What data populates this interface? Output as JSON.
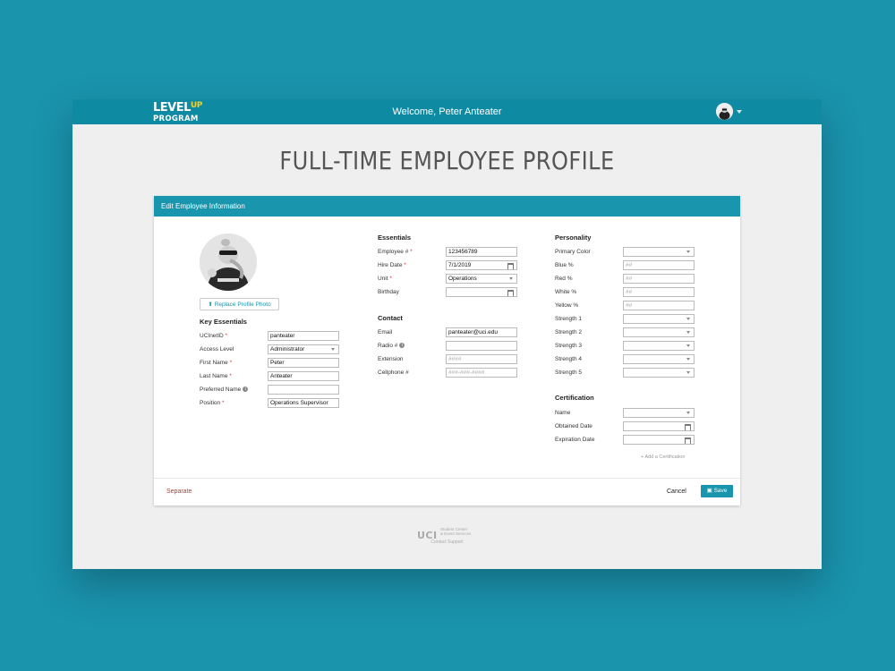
{
  "app": {
    "logo_line1": "LEVEL",
    "logo_up": "UP",
    "logo_line2": "PROGRAM",
    "welcome": "Welcome, Peter Anteater",
    "page_title": "FULL-TIME EMPLOYEE PROFILE"
  },
  "card": {
    "header": "Edit Employee Information",
    "replace_photo": "Replace Profile Photo"
  },
  "key_essentials": {
    "title": "Key Essentials",
    "fields": [
      {
        "label": "UCInetID",
        "required": "*",
        "value": "panteater"
      },
      {
        "label": "Access Level",
        "required": "",
        "value": "Administrator"
      },
      {
        "label": "First Name",
        "required": "*",
        "value": "Peter"
      },
      {
        "label": "Last Name",
        "required": "*",
        "value": "Anteater"
      },
      {
        "label": "Preferred Name",
        "required": "",
        "value": ""
      },
      {
        "label": "Position",
        "required": "*",
        "value": "Operations Supervisor"
      }
    ]
  },
  "essentials": {
    "title": "Essentials",
    "fields": [
      {
        "label": "Employee #",
        "required": "*",
        "value": "123456789"
      },
      {
        "label": "Hire Date",
        "required": "*",
        "value": "7/1/2019"
      },
      {
        "label": "Unit",
        "required": "*",
        "value": "Operations"
      },
      {
        "label": "Birthday",
        "required": "",
        "value": ""
      }
    ]
  },
  "contact": {
    "title": "Contact",
    "fields": [
      {
        "label": "Email",
        "value": "panteater@uci.edu",
        "placeholder": ""
      },
      {
        "label": "Radio #",
        "value": "",
        "placeholder": ""
      },
      {
        "label": "Extension",
        "value": "",
        "placeholder": "####"
      },
      {
        "label": "Cellphone #",
        "value": "",
        "placeholder": "###-###-####"
      }
    ]
  },
  "personality": {
    "title": "Personality",
    "fields": [
      {
        "label": "Primary Color",
        "value": "",
        "placeholder": ""
      },
      {
        "label": "Blue %",
        "value": "",
        "placeholder": "##"
      },
      {
        "label": "Red %",
        "value": "",
        "placeholder": "##"
      },
      {
        "label": "White %",
        "value": "",
        "placeholder": "##"
      },
      {
        "label": "Yellow %",
        "value": "",
        "placeholder": "##"
      },
      {
        "label": "Strength 1",
        "value": "",
        "placeholder": ""
      },
      {
        "label": "Strength 2",
        "value": "",
        "placeholder": ""
      },
      {
        "label": "Strength 3",
        "value": "",
        "placeholder": ""
      },
      {
        "label": "Strength 4",
        "value": "",
        "placeholder": ""
      },
      {
        "label": "Strength 5",
        "value": "",
        "placeholder": ""
      }
    ]
  },
  "certification": {
    "title": "Certification",
    "fields": [
      {
        "label": "Name",
        "value": ""
      },
      {
        "label": "Obtained Date",
        "value": ""
      },
      {
        "label": "Expiration Date",
        "value": ""
      }
    ],
    "add_label": "Add a Certification"
  },
  "actions": {
    "separate": "Separate",
    "cancel": "Cancel",
    "save": "Save"
  },
  "footer": {
    "uci": "UCI",
    "org_line1": "Student Center",
    "org_line2": "& Event Services",
    "contact": "Contact Support"
  },
  "colors": {
    "background": "#1a93ad",
    "accent": "#1a95ae",
    "danger": "#c0392b"
  }
}
